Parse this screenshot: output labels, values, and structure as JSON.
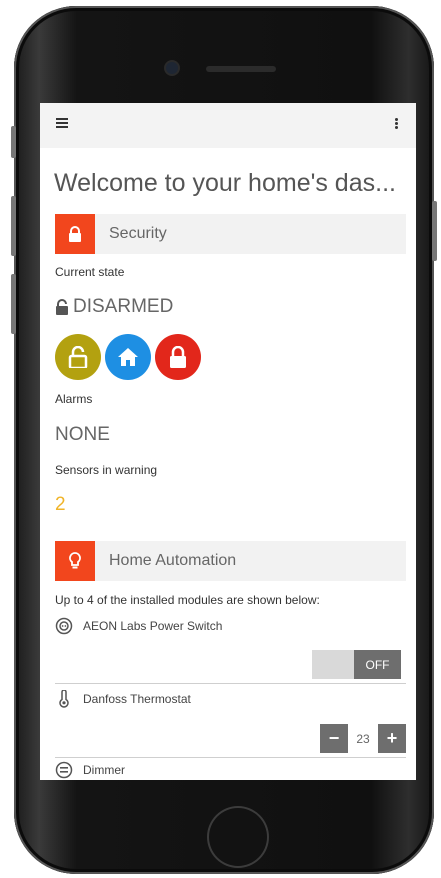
{
  "page": {
    "title": "Welcome to your home's das..."
  },
  "security": {
    "header": "Security",
    "current_state_label": "Current state",
    "current_state": "DISARMED",
    "alarms_label": "Alarms",
    "alarms_value": "NONE",
    "sensors_label": "Sensors in warning",
    "sensors_value": "2",
    "mode_buttons": [
      {
        "name": "disarm",
        "icon": "unlock-icon",
        "color": "#b3a110"
      },
      {
        "name": "home",
        "icon": "home-icon",
        "color": "#1e8fe3"
      },
      {
        "name": "arm",
        "icon": "lock-icon",
        "color": "#e2271b"
      }
    ]
  },
  "automation": {
    "header": "Home Automation",
    "intro": "Up to 4 of the installed modules are shown below:",
    "modules": [
      {
        "name": "AEON Labs Power Switch",
        "icon": "power-switch-icon",
        "control": "toggle",
        "state": "OFF"
      },
      {
        "name": "Danfoss Thermostat",
        "icon": "thermometer-icon",
        "control": "stepper",
        "value": "23",
        "minus": "−",
        "plus": "+"
      },
      {
        "name": "Dimmer",
        "icon": "dimmer-icon"
      }
    ]
  },
  "colors": {
    "accent": "#f2461d",
    "warning": "#f0b429",
    "control": "#6e6e6e"
  }
}
